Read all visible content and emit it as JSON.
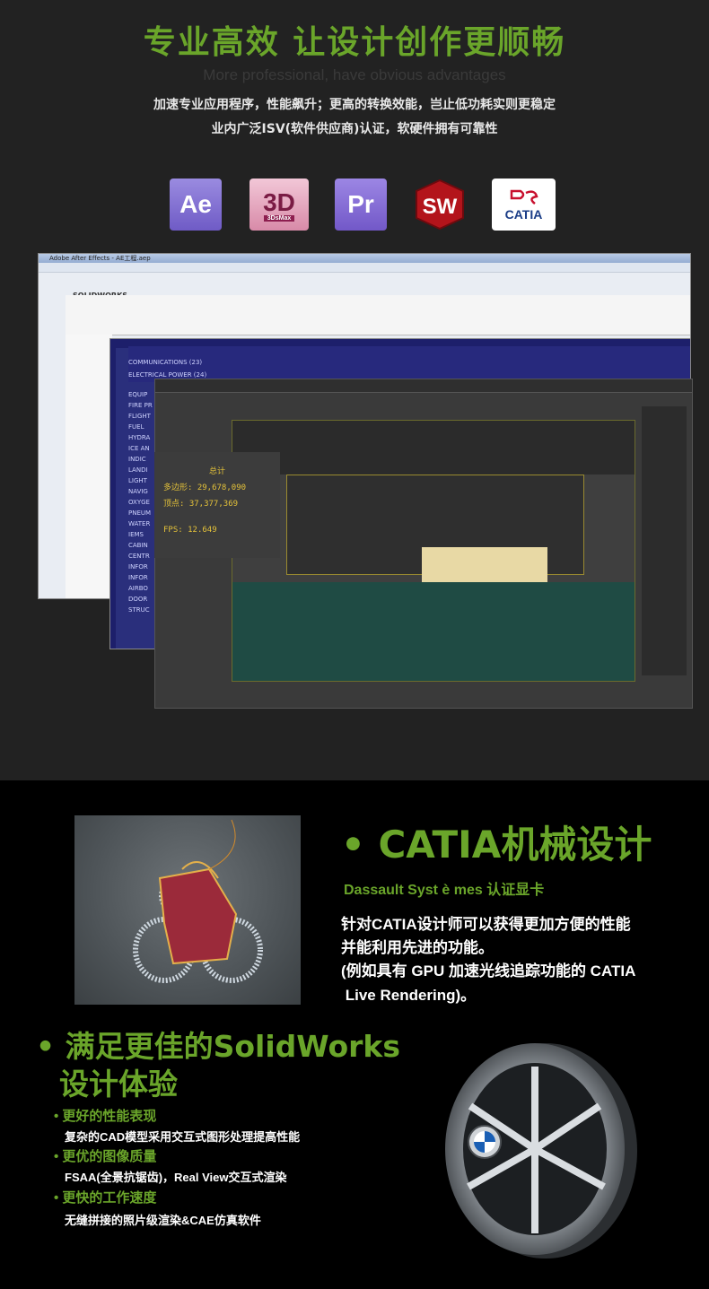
{
  "top": {
    "title": "专业高效  让设计创作更顺畅",
    "subtitle_en": "More professional, have obvious advantages",
    "desc1": "加速专业应用程序，性能飙升；更高的转换效能，岂止低功耗实则更稳定",
    "desc2": "业内广泛ISV(软件供应商)认证，软硬件拥有可靠性",
    "icons": [
      {
        "name": "after-effects-icon",
        "label": "Ae"
      },
      {
        "name": "3ds-max-icon",
        "label": "3D",
        "sub": "3DsMax"
      },
      {
        "name": "premiere-icon",
        "label": "Pr"
      },
      {
        "name": "solidworks-icon",
        "label": "SW"
      },
      {
        "name": "catia-icon",
        "label": "CATIA"
      }
    ],
    "screens": {
      "ae_title": "Adobe After Effects - AE工程.aep",
      "sw_brand": "SOLIDWORKS",
      "catia_items": [
        "COMMUNICATIONS (23)",
        "ELECTRICAL POWER (24)",
        "EQUIP",
        "FIRE PR",
        "FLIGHT",
        "FUEL",
        "HYDRA",
        "ICE AN",
        "INDIC",
        "LANDI",
        "LIGHT",
        "NAVIG",
        "OXYGE",
        "PNEUM",
        "WATER",
        "IEMS",
        "CABIN",
        "CENTR",
        "INFOR",
        "INFOR",
        "AIRBO",
        "DOOR",
        "STRUC"
      ],
      "stats": {
        "header": "总计",
        "poly_label": "多边形:",
        "poly_value": "29,678,090",
        "vert_label": "顶点:",
        "vert_value": "37,377,369",
        "fps_label": "FPS:",
        "fps_value": "12.649"
      }
    }
  },
  "catia": {
    "title": "• CATIA机械设计",
    "subtitle": "Dassault Syst è mes 认证显卡",
    "line1": "针对CATIA设计师可以获得更加方便的性能",
    "line2": "并能利用先进的功能。",
    "line3": "(例如具有 GPU 加速光线追踪功能的 CATIA",
    "line4": " Live Rendering)。"
  },
  "solidworks": {
    "title1": "• 满足更佳的SolidWorks",
    "title2": "设计体验",
    "items": [
      {
        "head": "• 更好的性能表现",
        "text": "复杂的CAD模型采用交互式图形处理提高性能"
      },
      {
        "head": "• 更优的图像质量",
        "text": "FSAA(全景抗锯齿)，Real View交互式渲染"
      },
      {
        "head": "• 更快的工作速度",
        "text": "无缝拼接的照片级渲染&CAE仿真软件"
      }
    ]
  },
  "colors": {
    "accent": "#6aa52a",
    "bg_top": "#222222",
    "bg_bottom": "#000000"
  }
}
